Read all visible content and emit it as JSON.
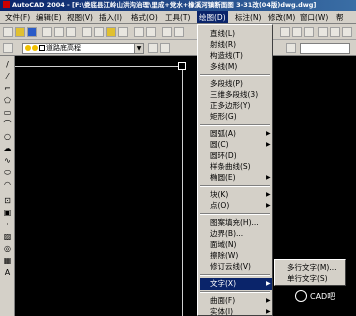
{
  "window": {
    "title": "AutoCAD 2004 - [F:\\娄底县江岭山洪沟治理\\里成+党水+橡溪河镇断面图 3-31改(04版)dwg.dwg]"
  },
  "menubar": {
    "items": [
      {
        "label": "文件(F)"
      },
      {
        "label": "编辑(E)"
      },
      {
        "label": "视图(V)"
      },
      {
        "label": "插入(I)"
      },
      {
        "label": "格式(O)"
      },
      {
        "label": "工具(T)"
      },
      {
        "label": "绘图(D)"
      },
      {
        "label": "标注(N)"
      },
      {
        "label": "修改(M)"
      },
      {
        "label": "窗口(W)"
      },
      {
        "label": "帮"
      }
    ],
    "active_index": 6
  },
  "layer_toolbar": {
    "layer_name": "道路底高程"
  },
  "draw_menu": {
    "items": [
      {
        "label": "直线(L)",
        "submenu": false
      },
      {
        "label": "射线(R)",
        "submenu": false
      },
      {
        "label": "构造线(T)",
        "submenu": false
      },
      {
        "label": "多线(M)",
        "submenu": false
      },
      {
        "label": "多段线(P)",
        "submenu": false
      },
      {
        "label": "三维多段线(3)",
        "submenu": false
      },
      {
        "label": "正多边形(Y)",
        "submenu": false
      },
      {
        "label": "矩形(G)",
        "submenu": false
      },
      {
        "label": "圆弧(A)",
        "submenu": true
      },
      {
        "label": "圆(C)",
        "submenu": true
      },
      {
        "label": "圆环(D)",
        "submenu": false
      },
      {
        "label": "样条曲线(S)",
        "submenu": false
      },
      {
        "label": "椭圆(E)",
        "submenu": true
      },
      {
        "label": "块(K)",
        "submenu": true
      },
      {
        "label": "点(O)",
        "submenu": true
      },
      {
        "label": "图案填充(H)...",
        "submenu": false
      },
      {
        "label": "边界(B)...",
        "submenu": false
      },
      {
        "label": "面域(N)",
        "submenu": false
      },
      {
        "label": "擦除(W)",
        "submenu": false
      },
      {
        "label": "修订云线(V)",
        "submenu": false
      },
      {
        "label": "文字(X)",
        "submenu": true
      },
      {
        "label": "曲面(F)",
        "submenu": true
      },
      {
        "label": "实体(I)",
        "submenu": true
      }
    ],
    "highlighted_index": 20
  },
  "text_submenu": {
    "items": [
      {
        "label": "多行文字(M)..."
      },
      {
        "label": "单行文字(S)"
      }
    ]
  },
  "left_toolbar": {
    "tools": [
      {
        "icon": "line-icon"
      },
      {
        "icon": "construction-line-icon"
      },
      {
        "icon": "polyline-icon"
      },
      {
        "icon": "polygon-icon"
      },
      {
        "icon": "rectangle-icon"
      },
      {
        "icon": "arc-icon"
      },
      {
        "icon": "circle-icon"
      },
      {
        "icon": "revision-cloud-icon"
      },
      {
        "icon": "spline-icon"
      },
      {
        "icon": "ellipse-icon"
      },
      {
        "icon": "ellipse-arc-icon"
      },
      {
        "icon": "insert-block-icon"
      },
      {
        "icon": "make-block-icon"
      },
      {
        "icon": "point-icon"
      },
      {
        "icon": "hatch-icon"
      },
      {
        "icon": "region-icon"
      },
      {
        "icon": "table-icon"
      },
      {
        "icon": "multiline-text-icon"
      }
    ],
    "text_tool_label": "A"
  },
  "watermark": {
    "text": "CAD吧"
  },
  "colors": {
    "menu_bg": "#d4d0c8",
    "highlight": "#0a246a",
    "canvas": "#000000",
    "title_start": "#0a246a",
    "title_end": "#3a6ea5"
  }
}
